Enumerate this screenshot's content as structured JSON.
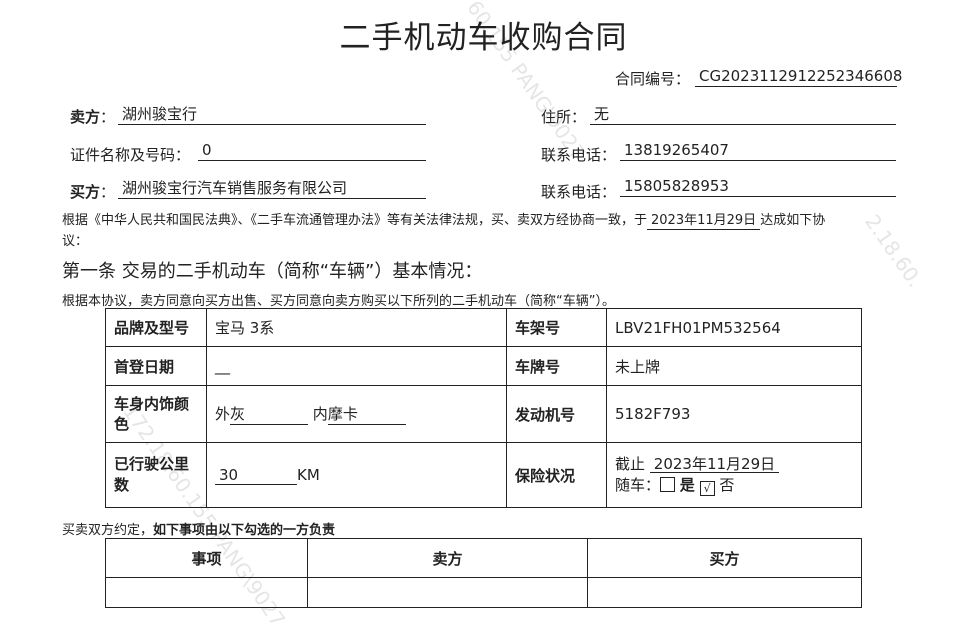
{
  "title": "二手机动车收购合同",
  "watermarks": [
    "60.155 PANG\\9027",
    "172.18.60.155 PANG\\9027",
    "2.18.60."
  ],
  "contract_no": {
    "label": "合同编号：",
    "value": "CG2023112912252346608"
  },
  "seller": {
    "label": "卖方",
    "colon": "：",
    "name": "湖州骏宝行",
    "address_label": "住所：",
    "address": "无",
    "id_label": "证件名称及号码：",
    "id": "0",
    "phone_label": "联系电话：",
    "phone": "13819265407"
  },
  "buyer": {
    "label": "买方",
    "colon": "：",
    "name": "湖州骏宝行汽车销售服务有限公司",
    "phone_label": "联系电话：",
    "phone": "15805828953"
  },
  "preamble": {
    "text1": "根据《中华人民共和国民法典》、《二手车流通管理办法》等有关法律法规，买、卖双方经协商一致，于",
    "date": "2023年11月29日",
    "text2": "达成如下协",
    "text3": "议："
  },
  "article1": {
    "heading": "第一条 交易的二手机动车（简称“车辆”）基本情况：",
    "intro": "根据本协议，卖方同意向买方出售、买方同意向卖方购买以下所列的二手机动车（简称“车辆”）。"
  },
  "vehicle": {
    "brand_label": "品牌及型号",
    "brand": "宝马 3系",
    "vin_label": "车架号",
    "vin": "LBV21FH01PM532564",
    "first_reg_label": "首登日期",
    "first_reg": "__",
    "plate_label": "车牌号",
    "plate": "未上牌",
    "color_label_1": "车身内饰颜",
    "color_label_2": "色",
    "ext_label": "外",
    "ext_color": "灰",
    "int_label": "内",
    "int_color": "摩卡",
    "engine_label": "发动机号",
    "engine": "5182F793",
    "mileage_label_1": "已行驶公里",
    "mileage_label_2": "数",
    "mileage": "30",
    "mileage_unit": "KM",
    "insurance_label": "保险状况",
    "ins_until_label": "截止",
    "ins_until": "2023年11月29日",
    "ins_with_car_label": "随车：",
    "yes": "是",
    "no": "否",
    "ins_with_car_checked": "no"
  },
  "agreement": {
    "text_normal": "买卖双方约定，",
    "text_bold": "如下事项由以下勾选的一方负责",
    "col1": "事项",
    "col2": "卖方",
    "col3": "买方"
  }
}
